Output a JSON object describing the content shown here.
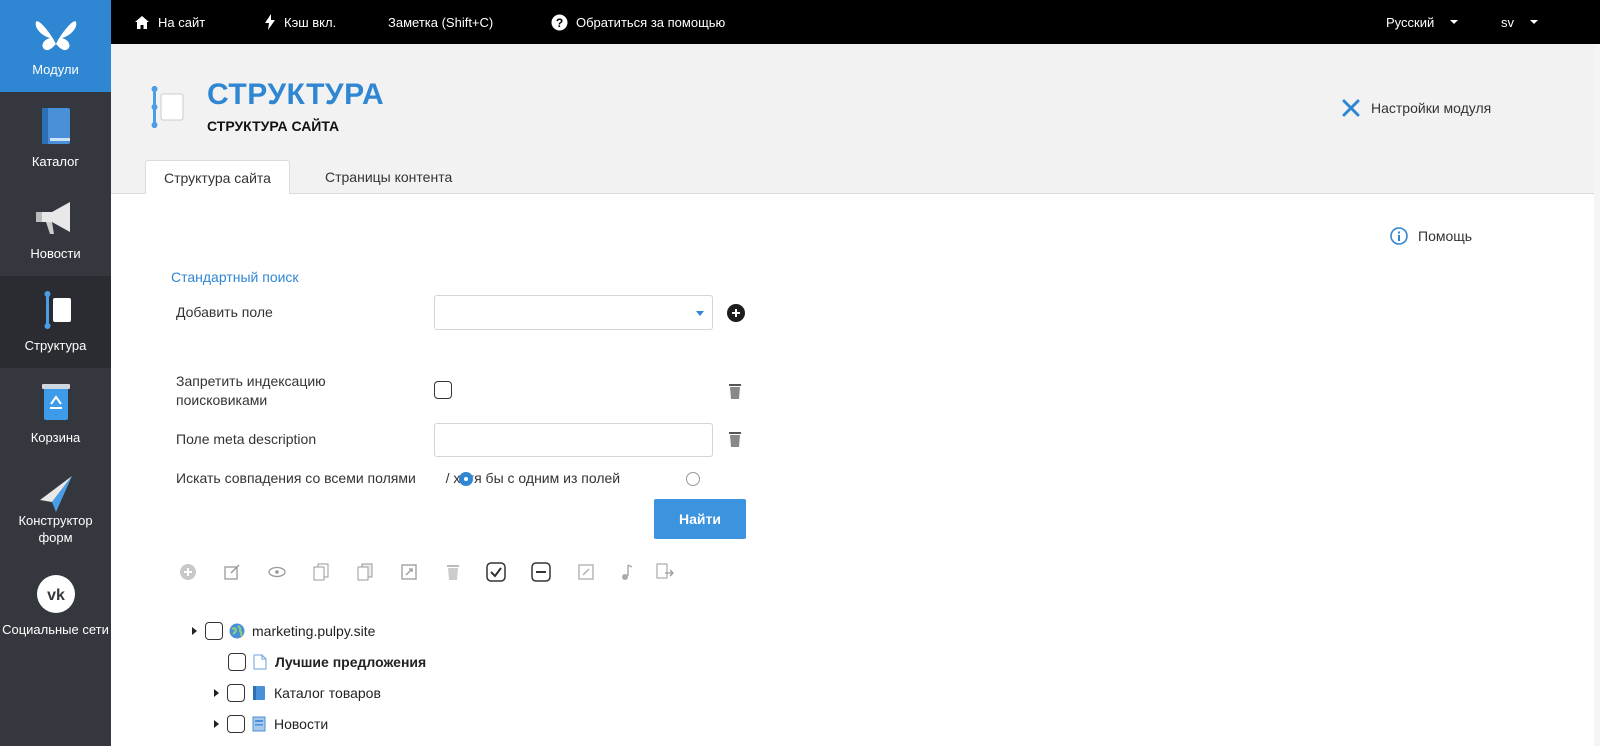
{
  "sidebar": {
    "items": [
      {
        "label": "Модули",
        "icon": "butterfly-icon"
      },
      {
        "label": "Каталог",
        "icon": "book-icon"
      },
      {
        "label": "Новости",
        "icon": "megaphone-icon"
      },
      {
        "label": "Структура",
        "icon": "structure-icon"
      },
      {
        "label": "Корзина",
        "icon": "recycle-bin-icon"
      },
      {
        "label": "Конструктор форм",
        "icon": "paper-plane-icon"
      },
      {
        "label": "Социальные сети",
        "icon": "vk-icon"
      }
    ]
  },
  "topbar": {
    "site_link": "На сайт",
    "cache": "Кэш вкл.",
    "note": "Заметка (Shift+C)",
    "help_request": "Обратиться за помощью",
    "language": "Русский",
    "user": "sv"
  },
  "header": {
    "title": "СТРУКТУРА",
    "subtitle": "СТРУКТУРА САЙТА",
    "module_settings": "Настройки модуля",
    "tabs": [
      {
        "label": "Структура сайта",
        "active": true
      },
      {
        "label": "Страницы контента",
        "active": false
      }
    ]
  },
  "main": {
    "help": "Помощь",
    "standard_search": "Стандартный поиск",
    "add_field_label": "Добавить поле",
    "add_field_value": "",
    "noindex_label_line1": "Запретить индексацию",
    "noindex_label_line2": "поисковиками",
    "meta_label": "Поле meta description",
    "meta_value": "",
    "match_all_label": "Искать совпадения со всеми полями",
    "match_any_label": "/ хотя бы с одним из полей",
    "find_button": "Найти"
  },
  "tree": {
    "items": [
      {
        "label": "marketing.pulpy.site",
        "icon": "globe-icon",
        "level": 0,
        "expandable": true
      },
      {
        "label": "Лучшие предложения",
        "icon": "page-icon",
        "level": 1,
        "expandable": false,
        "bold": true
      },
      {
        "label": "Каталог товаров",
        "icon": "catalog-icon",
        "level": 1,
        "expandable": true
      },
      {
        "label": "Новости",
        "icon": "news-icon",
        "level": 1,
        "expandable": true
      }
    ]
  },
  "colors": {
    "accent": "#2f86d3",
    "sidebar_bg": "#34373d",
    "topbar_bg": "#000000",
    "header_bg": "#f2f2f2"
  }
}
